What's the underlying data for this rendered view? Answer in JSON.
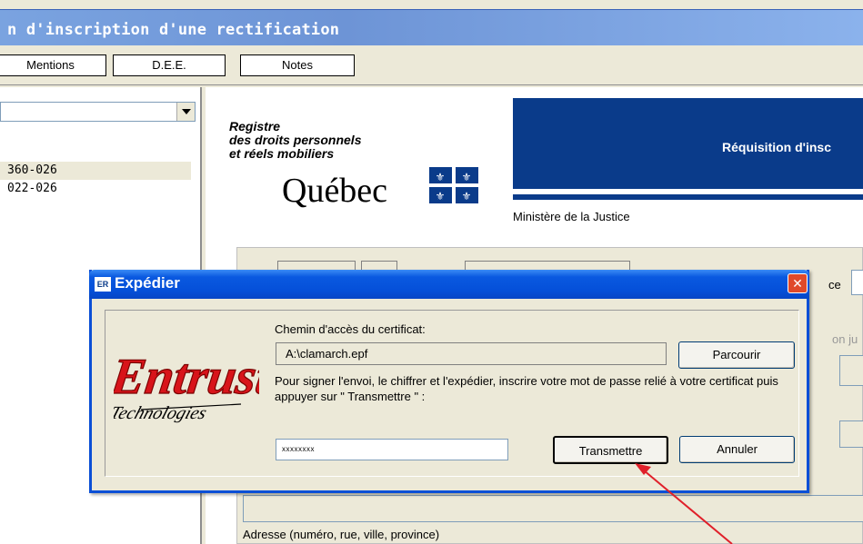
{
  "app": {
    "title": "n d'inscription d'une rectification",
    "tabs": [
      "Mentions",
      "D.E.E.",
      "Notes"
    ]
  },
  "left_panel": {
    "combo_value": "",
    "items": [
      "360-026",
      "022-026"
    ]
  },
  "document": {
    "header_lines": [
      "Registre",
      "des droits personnels",
      "et réels mobiliers"
    ],
    "quebec": "Québec",
    "banner_title": "Réquisition d'insc",
    "ministry": "Ministère de la Justice",
    "partial_labels": [
      "ce",
      "on ju"
    ],
    "address_label": "Adresse (numéro, rue, ville, province)"
  },
  "dialog": {
    "title": "Expédier",
    "app_icon_text": "ER",
    "close_glyph": "✕",
    "cert_label": "Chemin d'accès du certificat:",
    "cert_path": "A:\\clamarch.epf",
    "browse_label": "Parcourir",
    "instruction": "Pour signer l'envoi, le chiffrer et l'expédier, inscrire votre mot de passe relié à votre certificat puis appuyer sur \" Transmettre \" :",
    "password_mask": "xxxxxxxx",
    "transmit_label": "Transmettre",
    "cancel_label": "Annuler",
    "logo": {
      "main": "Entrust",
      "sub": "Technologies"
    }
  },
  "colors": {
    "banner_blue": "#0a3b8a",
    "dialog_titlebar": "#0550d9",
    "arrow_red": "#e0202a",
    "logo_red": "#d8141a"
  },
  "icons": [
    "chevron-down-icon",
    "close-icon",
    "app-icon",
    "fleur-de-lis-flag-icon"
  ]
}
